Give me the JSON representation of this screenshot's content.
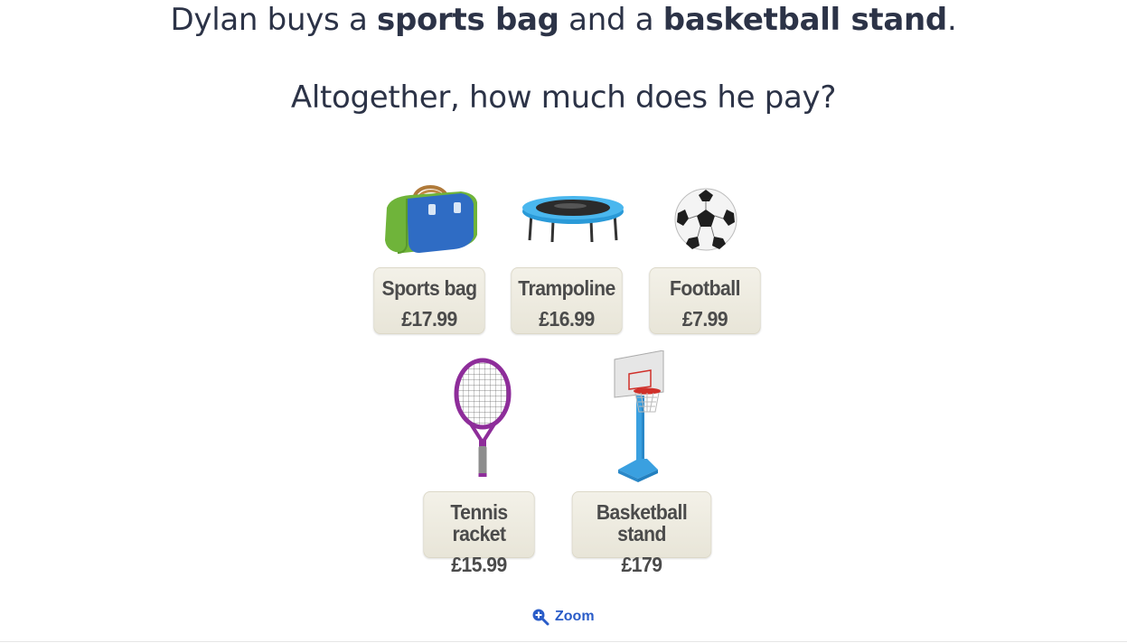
{
  "question": {
    "line1_prefix": "Dylan buys a ",
    "line1_item1": "sports bag",
    "line1_middle": " and a ",
    "line1_item2": "basketball stand",
    "line1_suffix": ".",
    "line2": "Altogether, how much does he pay?"
  },
  "items": [
    {
      "name": "Sports bag",
      "price": "£17.99",
      "icon": "sports-bag-icon"
    },
    {
      "name": "Trampoline",
      "price": "£16.99",
      "icon": "trampoline-icon"
    },
    {
      "name": "Football",
      "price": "£7.99",
      "icon": "football-icon"
    },
    {
      "name": "Tennis racket",
      "price": "£15.99",
      "icon": "tennis-racket-icon"
    },
    {
      "name": "Basketball stand",
      "price": "£179",
      "icon": "basketball-stand-icon"
    }
  ],
  "zoom": {
    "label": "Zoom",
    "icon": "zoom-in-icon"
  },
  "colors": {
    "text": "#2c3347",
    "link": "#2a5cc8",
    "card": "#eeece2"
  }
}
